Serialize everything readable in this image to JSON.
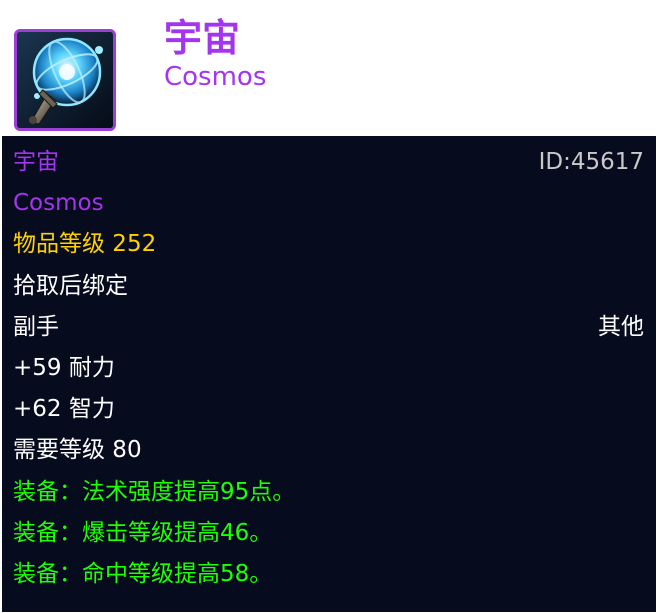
{
  "item": {
    "name_cn": "宇宙",
    "name_en": "Cosmos",
    "id_label": "ID:45617",
    "item_level": "物品等级 252",
    "binding": "拾取后绑定",
    "slot": "副手",
    "type": "其他",
    "stats": [
      "+59 耐力",
      "+62 智力"
    ],
    "required_level": "需要等级 80",
    "equip_effects": [
      "装备：法术强度提高95点。",
      "装备：爆击等级提高46。",
      "装备：命中等级提高58。"
    ],
    "icon": "cosmos-orb-icon"
  },
  "colors": {
    "epic": "#a335ee",
    "item_level": "#ffd100",
    "normal": "#ffffff",
    "equip": "#1eff00",
    "tooltip_bg": "#070b1e",
    "icon_border": "#9c3fd6"
  }
}
